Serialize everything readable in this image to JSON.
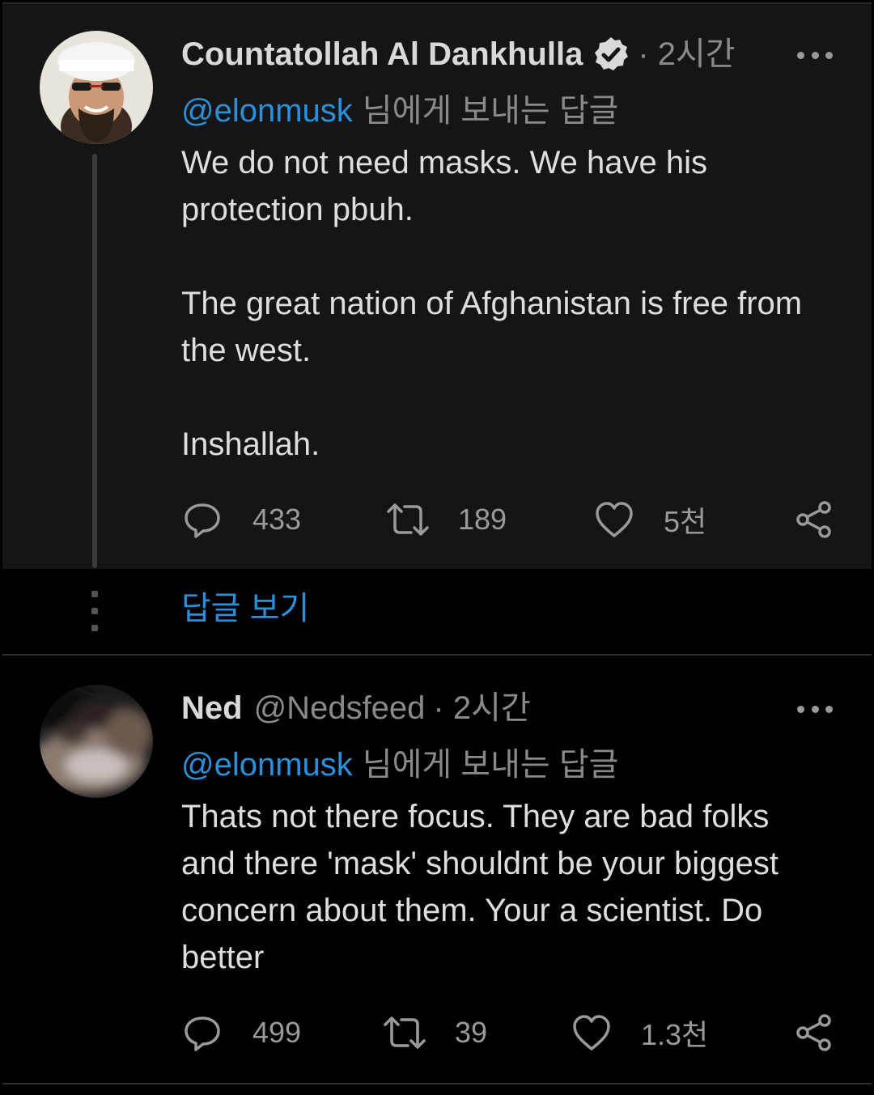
{
  "tweets": [
    {
      "author": "Countatollah Al Dankhulla",
      "verified": true,
      "handle": "",
      "time": "· 2시간",
      "reply_to_handle": "@elonmusk",
      "reply_to_suffix": "님에게 보내는 답글",
      "body": [
        "We do not need masks. We have his protection pbuh.",
        "The great nation of Afghanistan is free from the west.",
        "Inshallah."
      ],
      "replies": "433",
      "retweets": "189",
      "likes": "5천"
    },
    {
      "author": "Ned",
      "verified": false,
      "handle": "@Nedsfeed",
      "time": "· 2시간",
      "reply_to_handle": "@elonmusk",
      "reply_to_suffix": "님에게 보내는 답글",
      "body": [
        "Thats not there focus. They are bad folks and there 'mask' shouldnt be your biggest concern about them. Your a scientist. Do better"
      ],
      "replies": "499",
      "retweets": "39",
      "likes": "1.3천"
    }
  ],
  "show_replies_label": "답글 보기",
  "colors": {
    "link": "#2b90d9",
    "background": "#000000",
    "card": "#151515",
    "muted": "#8a8a8a"
  },
  "icons": [
    "reply-icon",
    "retweet-icon",
    "like-icon",
    "share-icon",
    "verified-icon",
    "more-icon"
  ]
}
